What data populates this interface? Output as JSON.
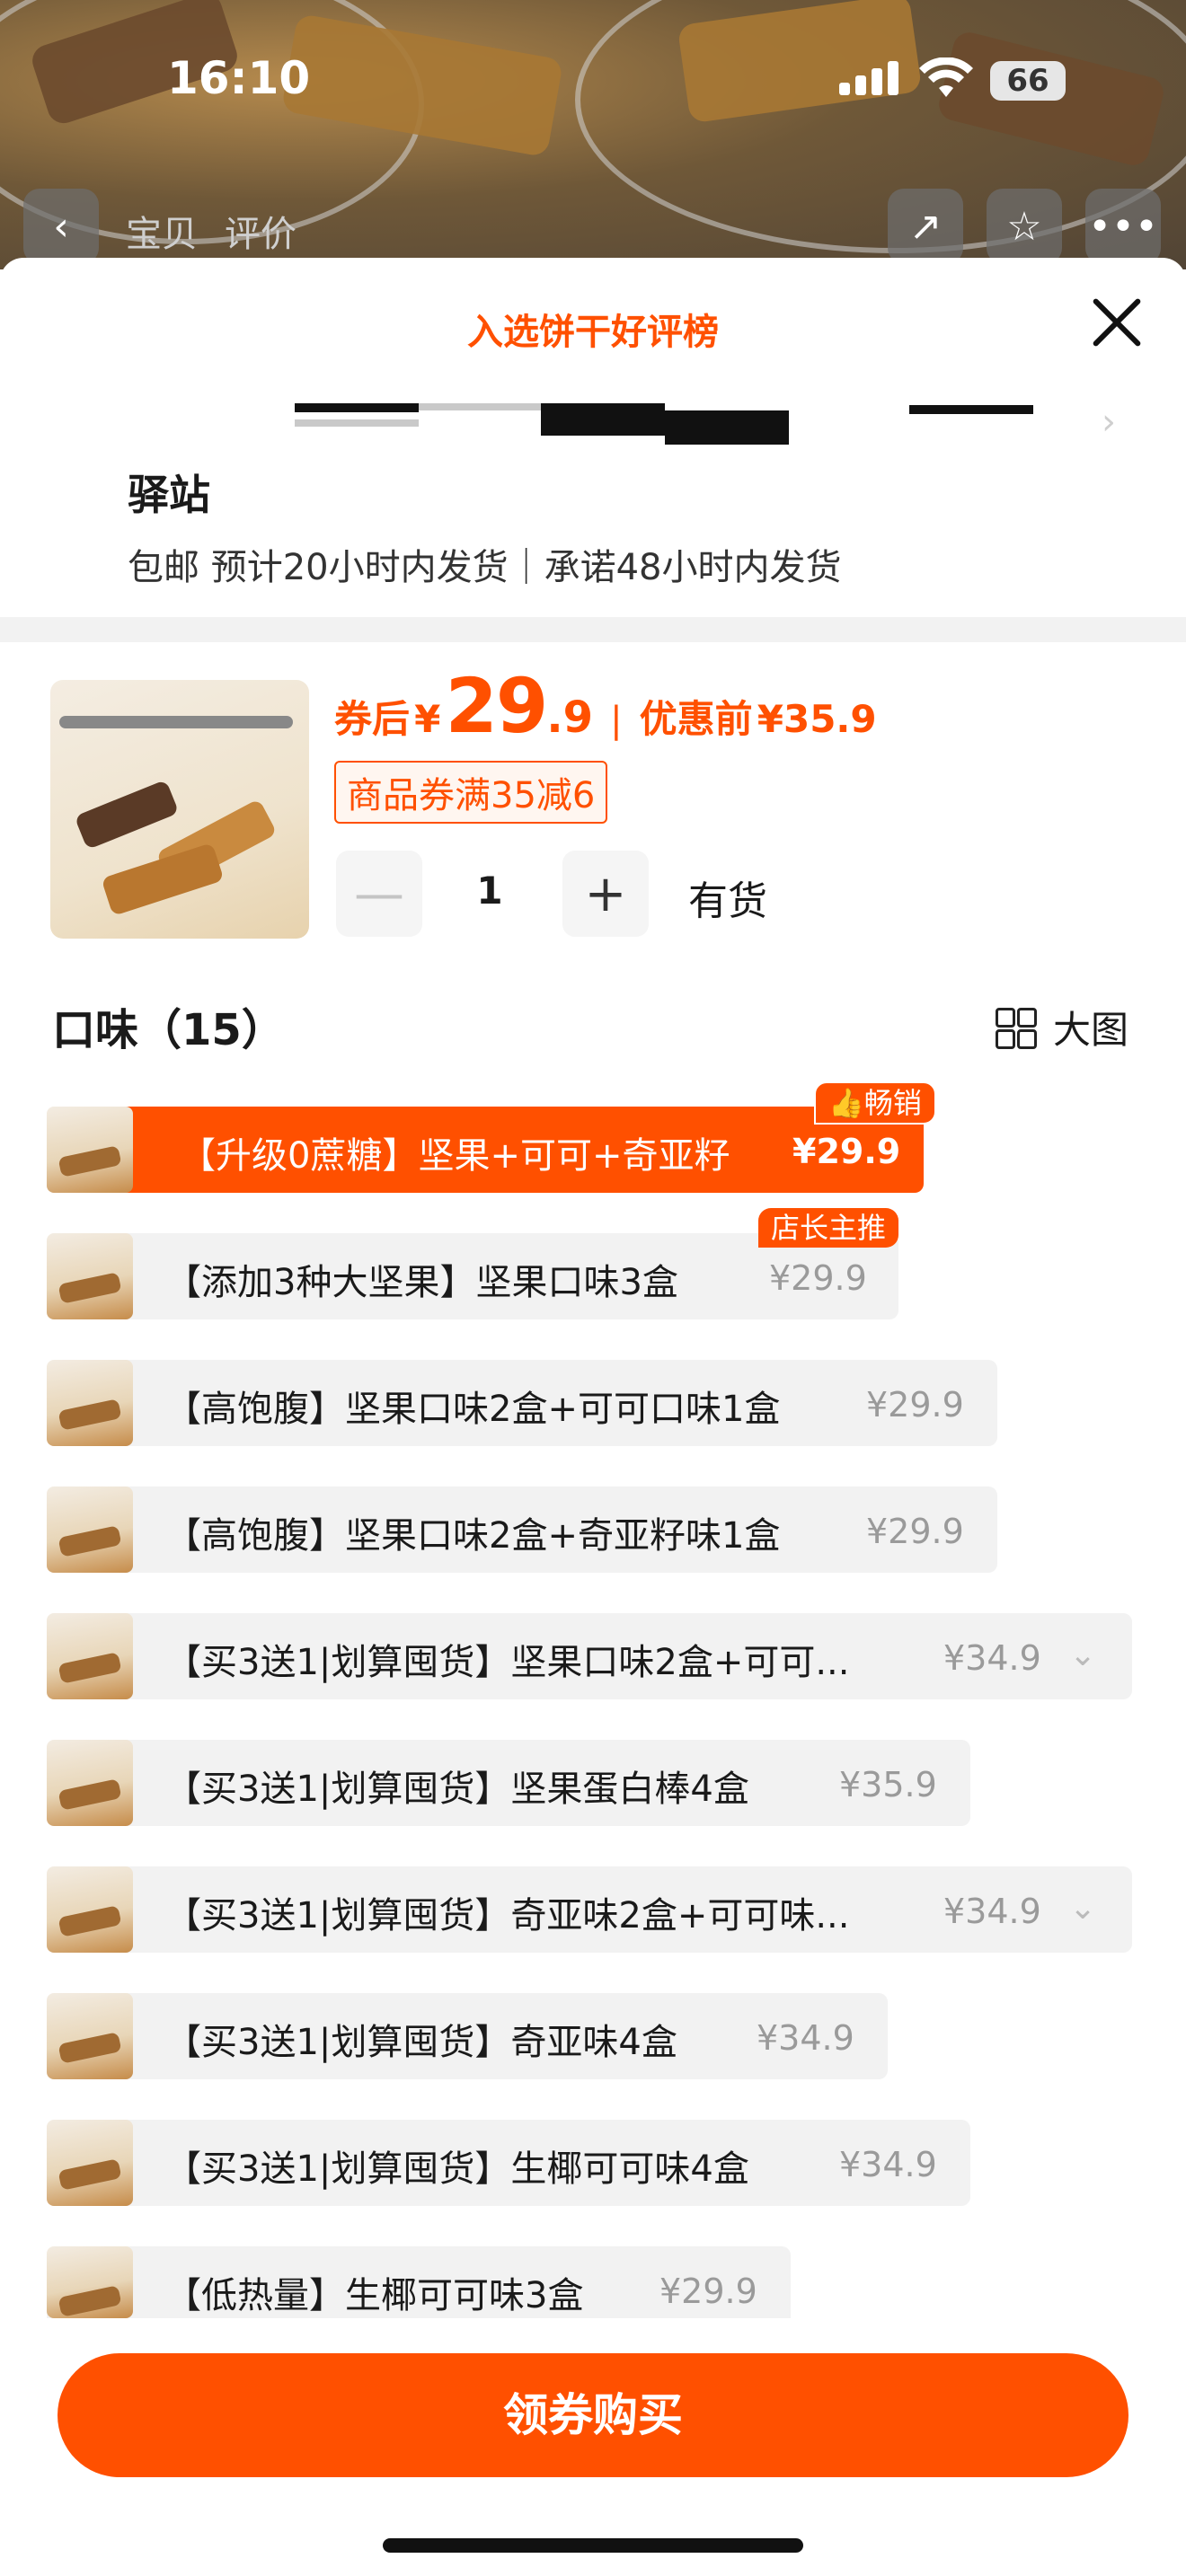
{
  "status_bar": {
    "time": "16:10",
    "battery": "66"
  },
  "top_nav": {
    "tabs": [
      "宝贝",
      "评价"
    ]
  },
  "sheet": {
    "rank_banner": "入选饼干好评榜",
    "address": {
      "title": "驿站",
      "shipping": "包邮 预计20小时内发货｜承诺48小时内发货"
    },
    "product": {
      "price_label": "券后",
      "currency": "¥",
      "price_int": "29",
      "price_dec": ".9",
      "separator": "|",
      "original_label": "优惠前",
      "original_price": "¥35.9",
      "coupon": "商品券满35减6",
      "quantity": "1",
      "stock": "有货",
      "minus": "—",
      "plus": "+"
    },
    "flavors": {
      "title": "口味（15）",
      "big_view": "大图",
      "items": [
        {
          "label": "【升级0蔗糖】坚果+可可+奇亚籽",
          "price": "¥29.9",
          "badge": "畅销"
        },
        {
          "label": "【添加3种大坚果】坚果口味3盒",
          "price": "¥29.9",
          "badge": "店长主推"
        },
        {
          "label": "【高饱腹】坚果口味2盒+可可口味1盒",
          "price": "¥29.9"
        },
        {
          "label": "【高饱腹】坚果口味2盒+奇亚籽味1盒",
          "price": "¥29.9"
        },
        {
          "label": "【买3送1|划算囤货】坚果口味2盒+可可...",
          "price": "¥34.9"
        },
        {
          "label": "【买3送1|划算囤货】坚果蛋白棒4盒",
          "price": "¥35.9"
        },
        {
          "label": "【买3送1|划算囤货】奇亚味2盒+可可味...",
          "price": "¥34.9"
        },
        {
          "label": "【买3送1|划算囤货】奇亚味4盒",
          "price": "¥34.9"
        },
        {
          "label": "【买3送1|划算囤货】生椰可可味4盒",
          "price": "¥34.9"
        },
        {
          "label": "【低热量】生椰可可味3盒",
          "price": "¥29.9"
        }
      ]
    },
    "buy_button": "领券购买"
  }
}
